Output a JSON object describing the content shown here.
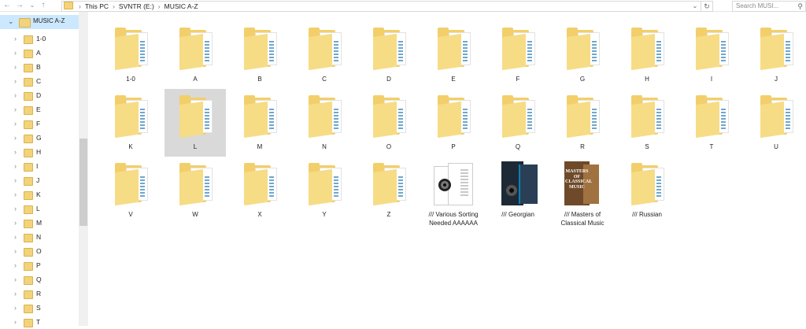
{
  "address_bar": {
    "back_icon": "arrow-left-icon",
    "forward_icon": "arrow-right-icon",
    "recent_icon": "chevron-down-icon",
    "up_icon": "arrow-up-icon",
    "crumbs": [
      "This PC",
      "SVNTR (E:)",
      "MUSIC A-Z"
    ],
    "crumb_separator": "›",
    "dropdown_icon": "⌄",
    "refresh_icon": "↻"
  },
  "search": {
    "placeholder": "Search MUSI...",
    "icon": "search-icon"
  },
  "nav": {
    "root_label": "MUSIC A-Z",
    "items": [
      "1-0",
      "A",
      "B",
      "C",
      "D",
      "E",
      "F",
      "G",
      "H",
      "I",
      "J",
      "K",
      "L",
      "M",
      "N",
      "O",
      "P",
      "Q",
      "R",
      "S",
      "T"
    ]
  },
  "folders": [
    {
      "label": "1-0"
    },
    {
      "label": "A"
    },
    {
      "label": "B"
    },
    {
      "label": "C"
    },
    {
      "label": "D"
    },
    {
      "label": "E"
    },
    {
      "label": "F"
    },
    {
      "label": "G"
    },
    {
      "label": "H"
    },
    {
      "label": "I"
    },
    {
      "label": "J"
    },
    {
      "label": "K"
    },
    {
      "label": "L"
    },
    {
      "label": "M"
    },
    {
      "label": "N"
    },
    {
      "label": "O"
    },
    {
      "label": "P"
    },
    {
      "label": "Q"
    },
    {
      "label": "R"
    },
    {
      "label": "S"
    },
    {
      "label": "T"
    },
    {
      "label": "U"
    },
    {
      "label": "V"
    },
    {
      "label": "W"
    },
    {
      "label": "X"
    },
    {
      "label": "Y"
    },
    {
      "label": "Z"
    },
    {
      "label": "/// Various Sorting Needed AAAAAA",
      "thumb": "various"
    },
    {
      "label": "/// Georgian",
      "thumb": "georgian"
    },
    {
      "label": "/// Masters of Classical Music",
      "thumb": "masters"
    },
    {
      "label": "/// Russian"
    }
  ],
  "selected_folder": "L",
  "album_art": {
    "masters_title": "MASTERS OF CLASSICAL MUSIC"
  }
}
